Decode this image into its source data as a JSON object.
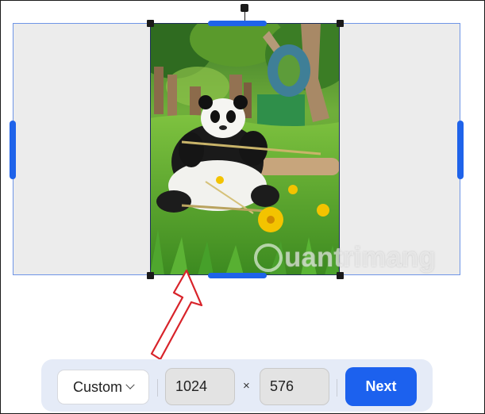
{
  "crop": {
    "preset_label": "Custom",
    "width_value": "1024",
    "times_symbol": "×",
    "height_value": "576",
    "next_label": "Next"
  },
  "watermark": {
    "text": "uantrimang"
  },
  "colors": {
    "accent": "#1c61ee",
    "handle": "#1f63ea",
    "arrow": "#d8232a",
    "toolbar_bg": "#e5ebf7"
  },
  "icons": {
    "dropdown": "chevron-down-icon",
    "annotation": "arrow-up-icon"
  }
}
